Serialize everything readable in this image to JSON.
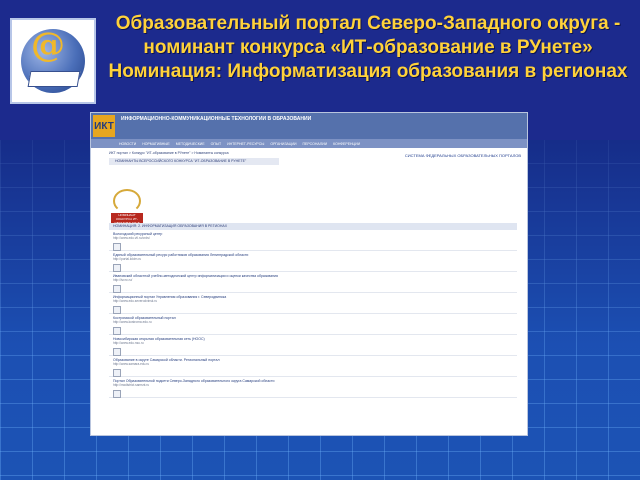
{
  "headline": "Образовательный портал Северо-Западного округа - номинант конкурса «ИТ-образование в РУнете» Номинация: Информатизация образования в регионах",
  "logo": {
    "icon": "globe-book-at-icon"
  },
  "screenshot": {
    "logo_text": "ИКТ",
    "site_title": "ИНФОРМАЦИОННО-КОММУНИКАЦИОННЫЕ ТЕХНОЛОГИИ В ОБРАЗОВАНИИ",
    "nav": [
      "НОВОСТИ",
      "НОРМАТИВНЫЕ",
      "МЕТОДИЧЕСКИЕ",
      "ОПЫТ",
      "ИНТЕРНЕТ-РЕСУРСЫ",
      "ОРГАНИЗАЦИИ",
      "ПЕРСОНАЛИИ",
      "КОНФЕРЕНЦИИ"
    ],
    "system_title": "СИСТЕМА ФЕДЕРАЛЬНЫХ ОБРАЗОВАТЕЛЬНЫХ ПОРТАЛОВ",
    "breadcrumb": "ИКТ портал > Конкурс \"ИТ-образование в РУнете\" > Номинанты конкурса",
    "contest_bar": "НОМИНАНТЫ ВСЕРОССИЙСКОГО КОНКУРСА \"ИТ-ОБРАЗОВАНИЕ В РУНЕТЕ\"",
    "badge_text": "НОМИНАНТ КОНКУРСА ИТ-ОБРАЗОВАНИЕ В РУНЕТЕ",
    "list_header": "НОМИНАЦИЯ: 2. ИНФОРМАТИЗАЦИЯ ОБРАЗОВАНИЯ В РЕГИОНАХ",
    "items": [
      {
        "title": "Вологодский ресурсный центр",
        "url": "http://www.edu.vtl.ru/cnkv/"
      },
      {
        "title": "Единый образовательный ресурс работников образования Ленинградской области",
        "url": "http://portal.lokirn.ru"
      },
      {
        "title": "Ивановский областной учебно-методический центр информатизации и оценки качества образования",
        "url": "http://ivcro.ru/"
      },
      {
        "title": "Информационный портал Управления образования г. Северодвинска",
        "url": "http://www.edu.severodvinsk.ru"
      },
      {
        "title": "Костромской образовательный портал",
        "url": "http://www.kostroma.edu.ru"
      },
      {
        "title": "Новосибирская открытая образовательная сеть (НООС)",
        "url": "http://www.edu.nsu.ru"
      },
      {
        "title": "Образование в округе Самарской области. Региональный портал",
        "url": "http://www.samara.edu.ru"
      },
      {
        "title": "Портал Образовательной подсети Северо-Западного образовательного округа Самарской области",
        "url": "http://nwdistrict.samsnt.ru"
      }
    ]
  }
}
